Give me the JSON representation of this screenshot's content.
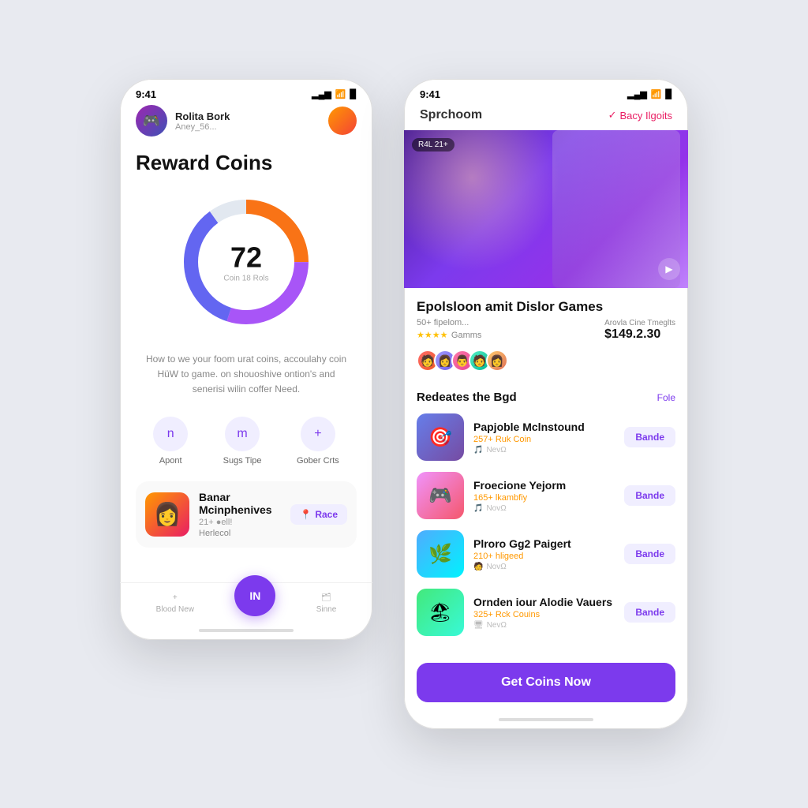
{
  "background_color": "#e8eaf0",
  "accent_color": "#7c3aed",
  "left_phone": {
    "status_bar": {
      "time": "9:41",
      "signal": "▂▄▆",
      "wifi": "WiFi",
      "battery": "🔋"
    },
    "user": {
      "name": "Rolita Bork",
      "subtitle": "Aney_56...",
      "avatar_emoji": "🎮"
    },
    "page_title": "Reward Coins",
    "donut": {
      "value": "72",
      "subtitle": "Coin 18 Rols",
      "segments": [
        {
          "color": "#f97316",
          "percentage": 25
        },
        {
          "color": "#a855f7",
          "percentage": 30
        },
        {
          "color": "#6366f1",
          "percentage": 35
        },
        {
          "color": "#e2e8f0",
          "percentage": 10
        }
      ]
    },
    "description": "How to we your foom urat coins, accoulahy coin HüW to game. on shouoshive ontion's and senerisi wilin coffer Need.",
    "actions": [
      {
        "label": "Apont",
        "icon": "n"
      },
      {
        "label": "Sugs Tipe",
        "icon": "m"
      },
      {
        "label": "Gober Crts",
        "icon": "+"
      }
    ],
    "user_card": {
      "name": "Banar Mcinphenives",
      "meta": "21+ ●ell!",
      "tag": "Herlecol",
      "avatar_emoji": "👩",
      "race_label": "Race"
    },
    "bottom_nav": [
      {
        "label": "Blood New",
        "icon": "+"
      },
      {
        "label": "IN",
        "center": true
      },
      {
        "label": "Sinne",
        "icon": "🗂"
      }
    ]
  },
  "right_phone": {
    "status_bar": {
      "time": "9:41",
      "signal": "▂▄▆",
      "wifi": "WiFi",
      "battery": "🔋"
    },
    "header": {
      "app_name": "Sprchoom",
      "back_label": "Bacy Ilgoits"
    },
    "hero": {
      "badge": "R4L 21+",
      "nav_icon": "▶"
    },
    "event": {
      "title": "Epolsloon amit Dislor Games",
      "subtitle": "50+ fipelom...",
      "rating": "★★★★",
      "rating_label": "Gamms",
      "price": "$149.2.30",
      "right_label": "Arovla Cine Tmeglts"
    },
    "participants": [
      "🧑",
      "👩",
      "👨",
      "🧑",
      "👩"
    ],
    "redeem_section": {
      "title": "Redeates the Bgd",
      "filter_label": "Fole",
      "games": [
        {
          "name": "Papjoble Mclnstound",
          "coins": "257+ Ruk Coin",
          "platform": "NevΩ",
          "emoji": "🎯",
          "btn_label": "Bande",
          "color_class": "g1"
        },
        {
          "name": "Froecione Yejorm",
          "coins": "165+ lkambfiy",
          "platform": "NovΩ",
          "emoji": "🎮",
          "btn_label": "Bande",
          "color_class": "g2"
        },
        {
          "name": "Plroro Gg2 Paigert",
          "coins": "210+ hligeed",
          "platform": "NovΩ",
          "emoji": "🌿",
          "btn_label": "Bande",
          "color_class": "g3"
        },
        {
          "name": "Ornden iour Alodie Vauers",
          "coins": "325+ Rck Couins",
          "platform": "NevΩ",
          "emoji": "🏖",
          "btn_label": "Bande",
          "color_class": "g4"
        }
      ]
    },
    "cta_button": "Get Coins Now"
  }
}
